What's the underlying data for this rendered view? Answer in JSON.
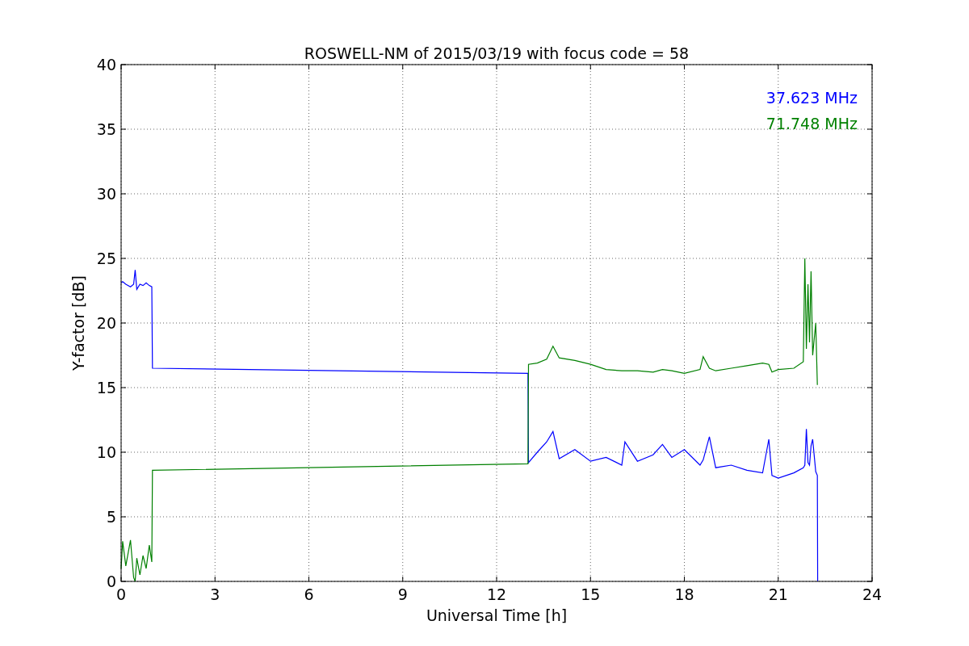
{
  "chart_data": {
    "type": "line",
    "title": "ROSWELL-NM of 2015/03/19 with focus code = 58",
    "xlabel": "Universal Time [h]",
    "ylabel": "Y-factor [dB]",
    "grid": true,
    "xlim": [
      0,
      24
    ],
    "ylim": [
      0,
      40
    ],
    "xticks": [
      0,
      3,
      6,
      9,
      12,
      15,
      18,
      21,
      24
    ],
    "yticks": [
      0,
      5,
      10,
      15,
      20,
      25,
      30,
      35,
      40
    ],
    "x": [
      0,
      0.05,
      0.15,
      0.3,
      0.4,
      0.45,
      0.5,
      0.6,
      0.7,
      0.8,
      0.9,
      0.98,
      1.0,
      13.0,
      13.02,
      13.3,
      13.6,
      13.8,
      14,
      14.5,
      15,
      15.5,
      16,
      16.1,
      16.5,
      17,
      17.3,
      17.6,
      18,
      18.5,
      18.6,
      18.8,
      19,
      19.5,
      20,
      20.5,
      20.7,
      20.8,
      21,
      21.5,
      21.8,
      21.85,
      21.9,
      21.95,
      22,
      22.05,
      22.1,
      22.2,
      22.25,
      22.26
    ],
    "series": [
      {
        "name": "37.623 MHz",
        "color": "#0000ff",
        "values": [
          23.1,
          23.2,
          23.0,
          22.8,
          23.0,
          24.1,
          22.6,
          23.0,
          22.9,
          23.1,
          22.9,
          22.8,
          16.5,
          16.1,
          9.2,
          10.0,
          10.8,
          11.6,
          9.5,
          10.2,
          9.3,
          9.6,
          9.0,
          10.8,
          9.3,
          9.8,
          10.6,
          9.6,
          10.2,
          9.0,
          9.4,
          11.2,
          8.8,
          9.0,
          8.6,
          8.4,
          11.0,
          8.2,
          8.0,
          8.4,
          8.8,
          9.0,
          11.8,
          9.2,
          9.0,
          10.5,
          11.0,
          8.5,
          8.2,
          0
        ]
      },
      {
        "name": "71.748 MHz",
        "color": "#008000",
        "values": [
          1.0,
          3.1,
          1.2,
          3.2,
          0.3,
          0.0,
          1.8,
          0.5,
          2.0,
          1.0,
          2.8,
          1.5,
          8.6,
          9.1,
          16.8,
          16.9,
          17.2,
          18.2,
          17.3,
          17.1,
          16.8,
          16.4,
          16.3,
          16.3,
          16.3,
          16.2,
          16.4,
          16.3,
          16.1,
          16.4,
          17.4,
          16.5,
          16.3,
          16.5,
          16.7,
          16.9,
          16.8,
          16.2,
          16.4,
          16.5,
          17.0,
          25.0,
          18.0,
          23.0,
          18.5,
          24.0,
          17.5,
          20.0,
          15.2,
          null
        ]
      }
    ]
  }
}
